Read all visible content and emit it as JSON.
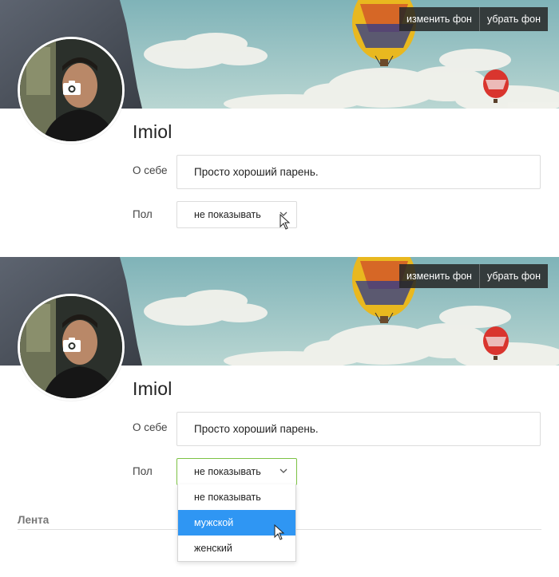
{
  "screen_before": {
    "cover": {
      "change_bg_label": "изменить фон",
      "remove_bg_label": "убрать фон"
    },
    "profile": {
      "username": "Imiol",
      "about_label": "О себе",
      "about_value": "Просто хороший парень.",
      "gender_label": "Пол",
      "gender_value": "не показывать"
    }
  },
  "screen_after": {
    "cover": {
      "change_bg_label": "изменить фон",
      "remove_bg_label": "убрать фон"
    },
    "profile": {
      "username": "Imiol",
      "about_label": "О себе",
      "about_value": "Просто хороший парень.",
      "gender_label": "Пол",
      "gender_value": "не показывать"
    },
    "gender_dropdown": {
      "options": [
        "не показывать",
        "мужской",
        "женский"
      ],
      "highlighted_option": "мужской"
    },
    "feed": {
      "title": "Лента"
    }
  },
  "colors": {
    "accent_green": "#7cc244",
    "option_highlight": "#2f96f3",
    "cover_button_bg": "#262626"
  },
  "icons": [
    "camera-icon",
    "chevron-down-icon",
    "mouse-pointer-icon",
    "hot-air-balloon"
  ]
}
